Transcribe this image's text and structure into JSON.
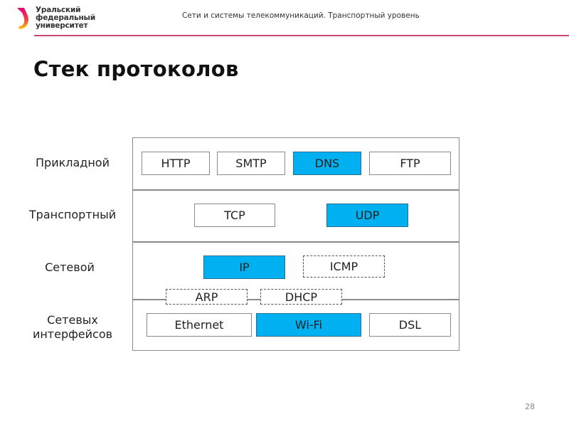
{
  "header": {
    "university_lines": [
      "Уральский",
      "федеральный",
      "университет"
    ],
    "course_title": "Сети и системы телекоммуникаций. Транспортный уровень",
    "accent_color": "#c8486e"
  },
  "slide": {
    "title": "Стек протоколов",
    "page_number": "28"
  },
  "diagram": {
    "highlight_color": "#00b0f0",
    "layers": [
      {
        "name": "Прикладной",
        "protocols": [
          {
            "label": "HTTP",
            "highlighted": false
          },
          {
            "label": "SMTP",
            "highlighted": false
          },
          {
            "label": "DNS",
            "highlighted": true
          },
          {
            "label": "FTP",
            "highlighted": false
          }
        ]
      },
      {
        "name": "Транспортный",
        "protocols": [
          {
            "label": "TCP",
            "highlighted": false
          },
          {
            "label": "UDP",
            "highlighted": true
          }
        ]
      },
      {
        "name": "Сетевой",
        "protocols": [
          {
            "label": "IP",
            "highlighted": true
          },
          {
            "label": "ICMP",
            "highlighted": false,
            "dashed": true
          }
        ]
      },
      {
        "name_lines": [
          "Сетевых",
          "интерфейсов"
        ],
        "protocols": [
          {
            "label": "Ethernet",
            "highlighted": false
          },
          {
            "label": "Wi-Fi",
            "highlighted": true
          },
          {
            "label": "DSL",
            "highlighted": false
          }
        ]
      }
    ],
    "boundary_protocols": [
      {
        "label": "ARP",
        "dashed": true
      },
      {
        "label": "DHCP",
        "dashed": true
      }
    ]
  }
}
